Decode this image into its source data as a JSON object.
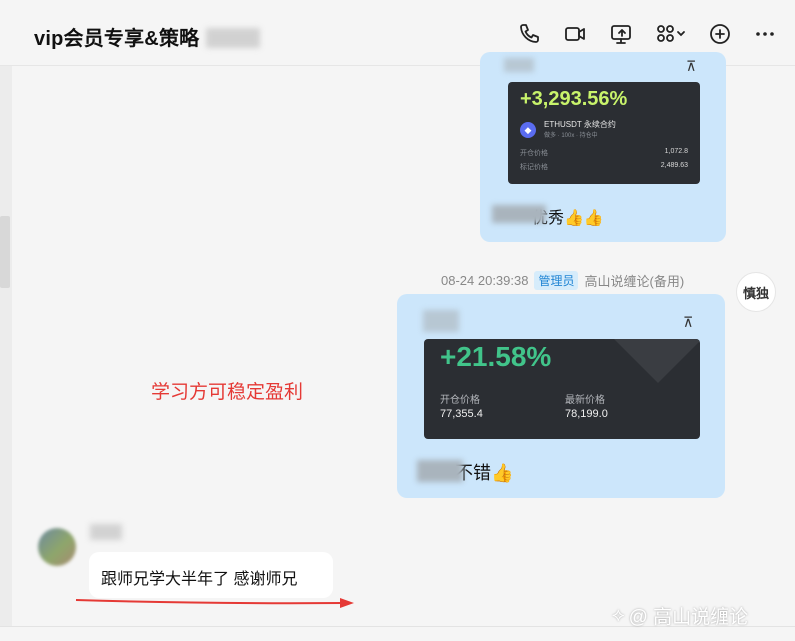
{
  "header": {
    "title": "vip会员专享&策略",
    "icons": [
      "phone-icon",
      "video-icon",
      "screen-share-icon",
      "apps-icon",
      "add-icon",
      "more-icon"
    ]
  },
  "messages": [
    {
      "side": "right",
      "card": {
        "pct": "+3,293.56%",
        "pair": "ETHUSDT 永续合约",
        "sub": "做多 · 100x · 持仓中",
        "row1_label": "开仓价格",
        "row1_value": "1,072.8",
        "row2_label": "标记价格",
        "row2_value": "2,489.63"
      },
      "text": "优秀👍👍"
    },
    {
      "side": "right",
      "timestamp": "08-24 20:39:38",
      "role_badge": "管理员",
      "sender": "高山说缠论(备用)",
      "avatar_text": "慎独",
      "card": {
        "pct": "+21.58%",
        "open_label": "开仓价格",
        "open_value": "77,355.4",
        "latest_label": "最新价格",
        "latest_value": "78,199.0"
      },
      "text": "不错👍"
    },
    {
      "side": "left",
      "text": "跟师兄学大半年了  感谢师兄"
    }
  ],
  "annotation": "学习方可稳定盈利",
  "watermark": "@ 高山说缠论",
  "colors": {
    "bubble_self": "#cce6fb",
    "annotation_red": "#e53935",
    "pct_green": "#41c48a",
    "pct_lime": "#c8f36b",
    "card_dark": "#2b2e33"
  }
}
